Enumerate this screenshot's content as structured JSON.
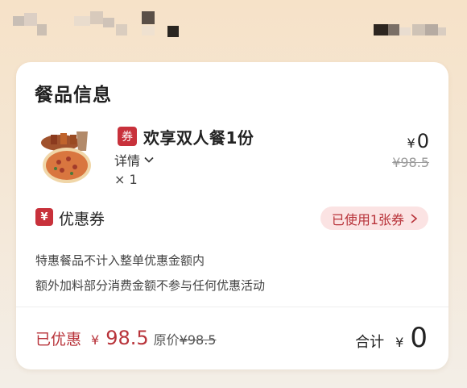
{
  "colors": {
    "accent": "#c8313b",
    "coupon_bg": "#fbe3e3",
    "muted": "#9a9a9a"
  },
  "card": {
    "title": "餐品信息"
  },
  "product": {
    "tag": "券",
    "name": "欢享双人餐1份",
    "details_label": "详情",
    "qty": "× 1",
    "price_currency": "¥",
    "price_now": "0",
    "price_old": "¥98.5"
  },
  "coupon": {
    "icon": "¥",
    "label": "优惠券",
    "used_label": "已使用1张券"
  },
  "notes": [
    "特惠餐品不计入整单优惠金额内",
    "额外加料部分消费金额不参与任何优惠活动"
  ],
  "summary": {
    "saved_label": "已优惠",
    "saved_currency": "¥",
    "saved_value": "98.5",
    "original_label": "原价",
    "original_value": "¥98.5",
    "total_label": "合计",
    "total_currency": "¥",
    "total_value": "0"
  }
}
